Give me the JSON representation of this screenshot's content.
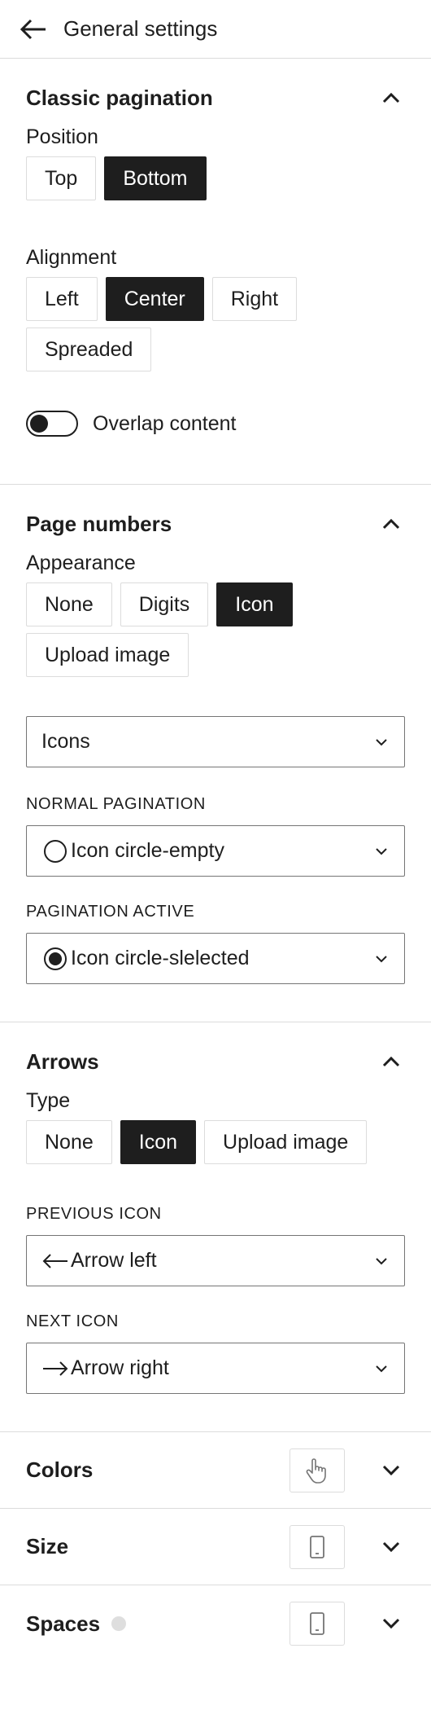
{
  "header": {
    "title": "General settings",
    "back_icon": "arrow-left-icon"
  },
  "classic": {
    "title": "Classic pagination",
    "position": {
      "label": "Position",
      "options": [
        "Top",
        "Bottom"
      ],
      "selected": "Bottom"
    },
    "alignment": {
      "label": "Alignment",
      "options": [
        "Left",
        "Center",
        "Right",
        "Spreaded"
      ],
      "selected": "Center"
    },
    "overlap": {
      "label": "Overlap content",
      "on": false
    }
  },
  "page_numbers": {
    "title": "Page numbers",
    "appearance": {
      "label": "Appearance",
      "options": [
        "None",
        "Digits",
        "Icon",
        "Upload image"
      ],
      "selected": "Icon"
    },
    "icons_select": {
      "value": "Icons"
    },
    "normal": {
      "label": "NORMAL PAGINATION",
      "value": "Icon circle-empty",
      "icon": "circle-empty-icon"
    },
    "active": {
      "label": "PAGINATION ACTIVE",
      "value": "Icon circle-slelected",
      "icon": "circle-selected-icon"
    }
  },
  "arrows": {
    "title": "Arrows",
    "type": {
      "label": "Type",
      "options": [
        "None",
        "Icon",
        "Upload image"
      ],
      "selected": "Icon"
    },
    "previous": {
      "label": "PREVIOUS ICON",
      "value": "Arrow left",
      "icon": "arrow-left-icon"
    },
    "next": {
      "label": "NEXT ICON",
      "value": "Arrow right",
      "icon": "arrow-right-icon"
    }
  },
  "collapsed_panels": [
    {
      "title": "Colors",
      "tool_icon": "hand-pointer-icon"
    },
    {
      "title": "Size",
      "tool_icon": "mobile-device-icon"
    },
    {
      "title": "Spaces",
      "tool_icon": "mobile-device-icon",
      "indicator": "grey-dot"
    }
  ],
  "colors": {
    "active": "#1e1e1e",
    "border": "#dcdcdc",
    "text": "#1e1e1e"
  }
}
